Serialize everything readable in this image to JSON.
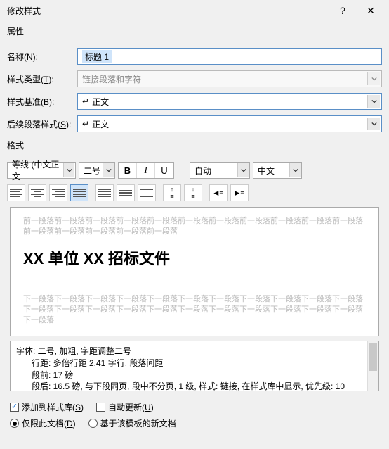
{
  "titlebar": {
    "title": "修改样式",
    "help": "?",
    "close": "✕"
  },
  "section_properties_label": "属性",
  "labels": {
    "name": "名称(N):",
    "style_type": "样式类型(T):",
    "based_on": "样式基准(B):",
    "next_para": "后续段落样式(S):"
  },
  "values": {
    "name": "标题 1",
    "style_type": "链接段落和字符",
    "based_on": "正文",
    "next_para": "正文",
    "return_arrow": "↵"
  },
  "section_format_label": "格式",
  "format": {
    "font": "等线 (中文正文",
    "size": "二号",
    "bold": "B",
    "italic": "I",
    "underline": "U",
    "auto_color": "自动",
    "script": "中文"
  },
  "paragraph_icons": {
    "increase_indent_tip": "increase-indent",
    "decrease_indent_tip": "decrease-indent"
  },
  "preview": {
    "before": "前一段落前一段落前一段落前一段落前一段落前一段落前一段落前一段落前一段落前一段落前一段落前一段落前一段落前一段落前一段落前一段落",
    "heading": "XX 单位 XX 招标文件",
    "after": "下一段落下一段落下一段落下一段落下一段落下一段落下一段落下一段落下一段落下一段落下一段落下一段落下一段落下一段落下一段落下一段落下一段落下一段落下一段落下一段落下一段落下一段落下一段落"
  },
  "description": {
    "line1": "字体: 二号, 加粗, 字距调整二号",
    "line2": "行距: 多倍行距 2.41 字行, 段落间距",
    "line3": "段前: 17 磅",
    "line4": "段后: 16.5 磅, 与下段同页, 段中不分页, 1 级, 样式: 链接, 在样式库中显示, 优先级: 10"
  },
  "checks": {
    "add_to_gallery": "添加到样式库(S)",
    "auto_update": "自动更新(U)"
  },
  "radios": {
    "this_doc": "仅限此文档(D)",
    "template": "基于该模板的新文档"
  }
}
